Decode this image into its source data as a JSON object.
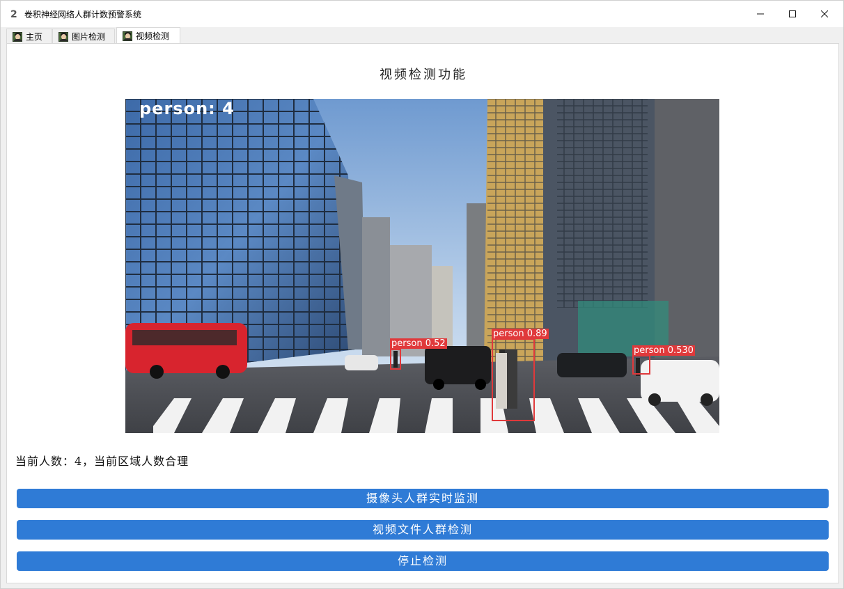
{
  "window": {
    "title": "卷积神经网络人群计数预警系统",
    "app_icon": "2",
    "controls": {
      "minimize": "minimize-icon",
      "maximize": "maximize-icon",
      "close": "close-icon"
    }
  },
  "tabs": [
    {
      "label": "主页",
      "active": false
    },
    {
      "label": "图片检测",
      "active": false
    },
    {
      "label": "视频检测",
      "active": true
    }
  ],
  "main": {
    "heading": "视频检测功能",
    "video": {
      "count_overlay": "person: 4",
      "detections": [
        {
          "label": "person 0.52"
        },
        {
          "label": "person 0.89"
        },
        {
          "label": "person 0.530"
        }
      ]
    },
    "status_text": "当前人数：4，当前区域人数合理",
    "buttons": {
      "camera": "摄像头人群实时监测",
      "video_file": "视频文件人群检测",
      "stop": "停止检测"
    }
  },
  "colors": {
    "accent_button": "#2f7bd6",
    "detection_box": "#e0393b"
  }
}
